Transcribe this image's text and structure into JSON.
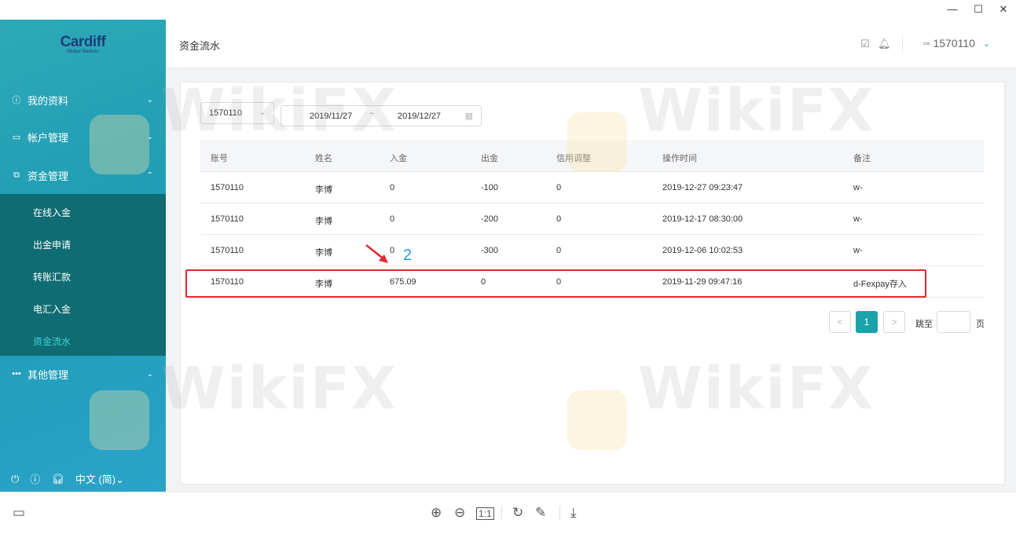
{
  "window": {
    "minimize": "—",
    "maximize": "☐",
    "close": "✕"
  },
  "sidebar": {
    "logo": "Cardiff",
    "logo_sub": "Global Markets",
    "menu": [
      {
        "label": "我的资料",
        "icon": "info-circle-icon"
      },
      {
        "label": "帐户管理",
        "icon": "card-icon"
      },
      {
        "label": "资金管理",
        "icon": "money-icon"
      },
      {
        "label": "其他管理",
        "icon": "more-dots-icon"
      }
    ],
    "submenu": [
      "在线入金",
      "出金申请",
      "转账汇款",
      "电汇入金",
      "资金流水"
    ],
    "language": "中文 (简)"
  },
  "header": {
    "title": "资金流水",
    "user": "1570110"
  },
  "filters": {
    "account": "1570110",
    "date_start": "2019/11/27",
    "date_end": "2019/12/27",
    "separator": "~"
  },
  "table": {
    "columns": [
      "账号",
      "姓名",
      "入金",
      "出金",
      "信用调整",
      "操作时间",
      "备注"
    ],
    "rows": [
      [
        "1570110",
        "李博",
        "0",
        "-100",
        "0",
        "2019-12-27 09:23:47",
        "w-"
      ],
      [
        "1570110",
        "李博",
        "0",
        "-200",
        "0",
        "2019-12-17 08:30:00",
        "w-"
      ],
      [
        "1570110",
        "李博",
        "0",
        "-300",
        "0",
        "2019-12-06 10:02:53",
        "w-"
      ],
      [
        "1570110",
        "李博",
        "675.09",
        "0",
        "0",
        "2019-11-29 09:47:16",
        "d-Fexpay存入"
      ]
    ]
  },
  "annotation": {
    "number": "2"
  },
  "pagination": {
    "prev": "<",
    "current": "1",
    "next": ">",
    "jump_label": "跳至",
    "page_label": "页"
  },
  "watermark": {
    "text": "WikiFX"
  },
  "colors": {
    "accent": "#1aa3a8",
    "sidebar": "#1f9cb4",
    "submenu": "#0e6c72",
    "highlight": "#e5262e",
    "annotation": "#2b9be0"
  }
}
